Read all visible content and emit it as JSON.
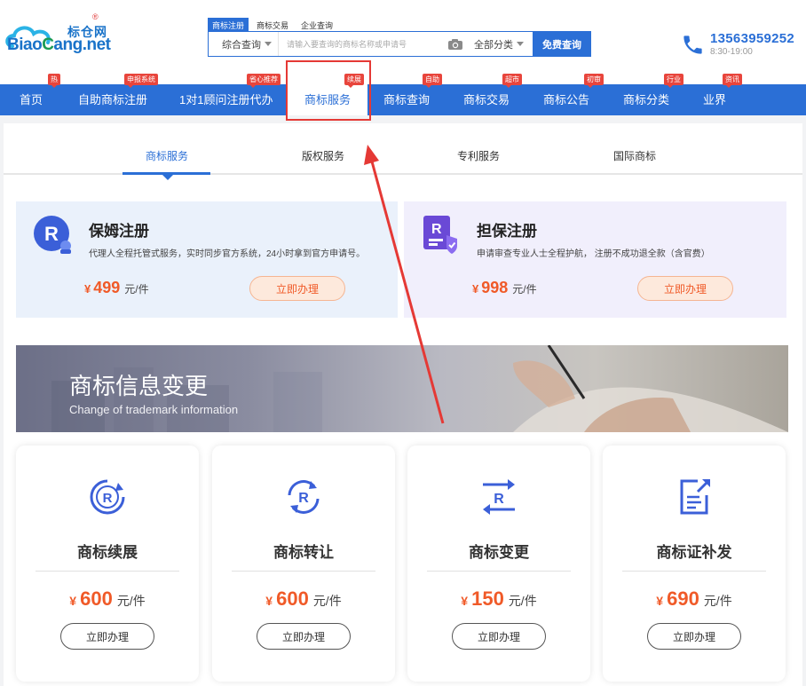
{
  "colors": {
    "brand": "#2b6fd6",
    "price": "#f05a28",
    "badge": "#e8453c",
    "annotation": "#e53935"
  },
  "logo": {
    "cn": "标仓网",
    "reg": "®",
    "en_prefix": "Biao",
    "en_mid": "C",
    "en_suffix": "ang.net"
  },
  "search": {
    "tabs": [
      "商标注册",
      "商标交易",
      "企业查询"
    ],
    "scope": "综合查询",
    "placeholder": "请输入要查询的商标名称或申请号",
    "category": "全部分类",
    "button": "免费查询"
  },
  "contact": {
    "phone": "13563959252",
    "hours": "8:30-19:00"
  },
  "nav": {
    "items": [
      {
        "label": "首页",
        "badge": "热"
      },
      {
        "label": "自助商标注册",
        "badge": "申报系统"
      },
      {
        "label": "1对1顾问注册代办",
        "badge": "省心推荐"
      },
      {
        "label": "商标服务",
        "badge": "续展"
      },
      {
        "label": "商标查询",
        "badge": "自助"
      },
      {
        "label": "商标交易",
        "badge": "超市"
      },
      {
        "label": "商标公告",
        "badge": "初审"
      },
      {
        "label": "商标分类",
        "badge": "行业"
      },
      {
        "label": "业界",
        "badge": "资讯"
      }
    ]
  },
  "tabs": [
    "商标服务",
    "版权服务",
    "专利服务",
    "国际商标"
  ],
  "promos": [
    {
      "title": "保姆注册",
      "desc": "代理人全程托管式服务，实时同步官方系统，24小时拿到官方申请号。",
      "yen": "¥",
      "price": "499",
      "unit": "元/件",
      "button": "立即办理"
    },
    {
      "title": "担保注册",
      "desc": "申请审查专业人士全程护航， 注册不成功退全款（含官费）",
      "yen": "¥",
      "price": "998",
      "unit": "元/件",
      "button": "立即办理"
    }
  ],
  "banner": {
    "title": "商标信息变更",
    "subtitle": "Change of trademark information"
  },
  "cards": [
    {
      "title": "商标续展",
      "yen": "¥",
      "price": "600",
      "unit": "元/件",
      "button": "立即办理",
      "icon": "trademark-renewal-icon"
    },
    {
      "title": "商标转让",
      "yen": "¥",
      "price": "600",
      "unit": "元/件",
      "button": "立即办理",
      "icon": "trademark-transfer-icon"
    },
    {
      "title": "商标变更",
      "yen": "¥",
      "price": "150",
      "unit": "元/件",
      "button": "立即办理",
      "icon": "trademark-change-icon"
    },
    {
      "title": "商标证补发",
      "yen": "¥",
      "price": "690",
      "unit": "元/件",
      "button": "立即办理",
      "icon": "certificate-reissue-icon"
    }
  ]
}
